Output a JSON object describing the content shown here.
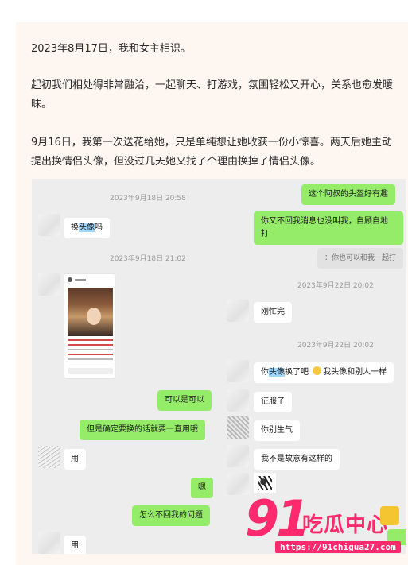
{
  "article": {
    "paragraphs": [
      "2023年8月17日，我和女主相识。",
      "起初我们相处得非常融洽，一起聊天、打游戏，氛围轻松又开心，关系也愈发暧昧。",
      "9月16日，我第一次送花给她，只是单纯想让她收获一份小惊喜。两天后她主动提出换情侣头像，但没过几天她又找了个理由换掉了情侣头像。"
    ]
  },
  "chat": {
    "timestamps": [
      "2023年9月18日 20:58",
      "2023年9月18日 21:02",
      "2023年9月22日 20:02",
      "2023年9月22日 20:02"
    ],
    "messages": {
      "m1": "这个阿叔的头盔好有趣",
      "m2a": "换",
      "m2b": "头像",
      "m2c": "吗",
      "m3a": "你又不回我消息也没叫我，自顾自地",
      "m3b": "打",
      "m4": "：你也可以和我一起打",
      "m5": "刚忙完",
      "m6a": "你",
      "m6b": "头像",
      "m6c": "换了吧 ",
      "m6d": "我头像和别人一样",
      "m7": "可以是可以",
      "m8": "征服了",
      "m9": "但是确定要换的话就要一直用哦",
      "m10": "你别生气",
      "m11": "用",
      "m12": "我不是故意有这样的",
      "m13": "嗯",
      "m14": "怎么不回我的问题",
      "m15": "用"
    },
    "icons": [
      "laugh-emoji-icon",
      "screenshot-image",
      "sticker-image"
    ]
  },
  "watermark": {
    "number": "91",
    "name": "吃瓜中心",
    "url": "https://91chigua27.com"
  },
  "colors": {
    "page_bg": "#fdf6f1",
    "chat_bg": "#ededed",
    "bubble_out": "#95ec69",
    "bubble_in": "#ffffff",
    "highlight": "#9fd8ff",
    "watermark": "#ff2a6e"
  }
}
